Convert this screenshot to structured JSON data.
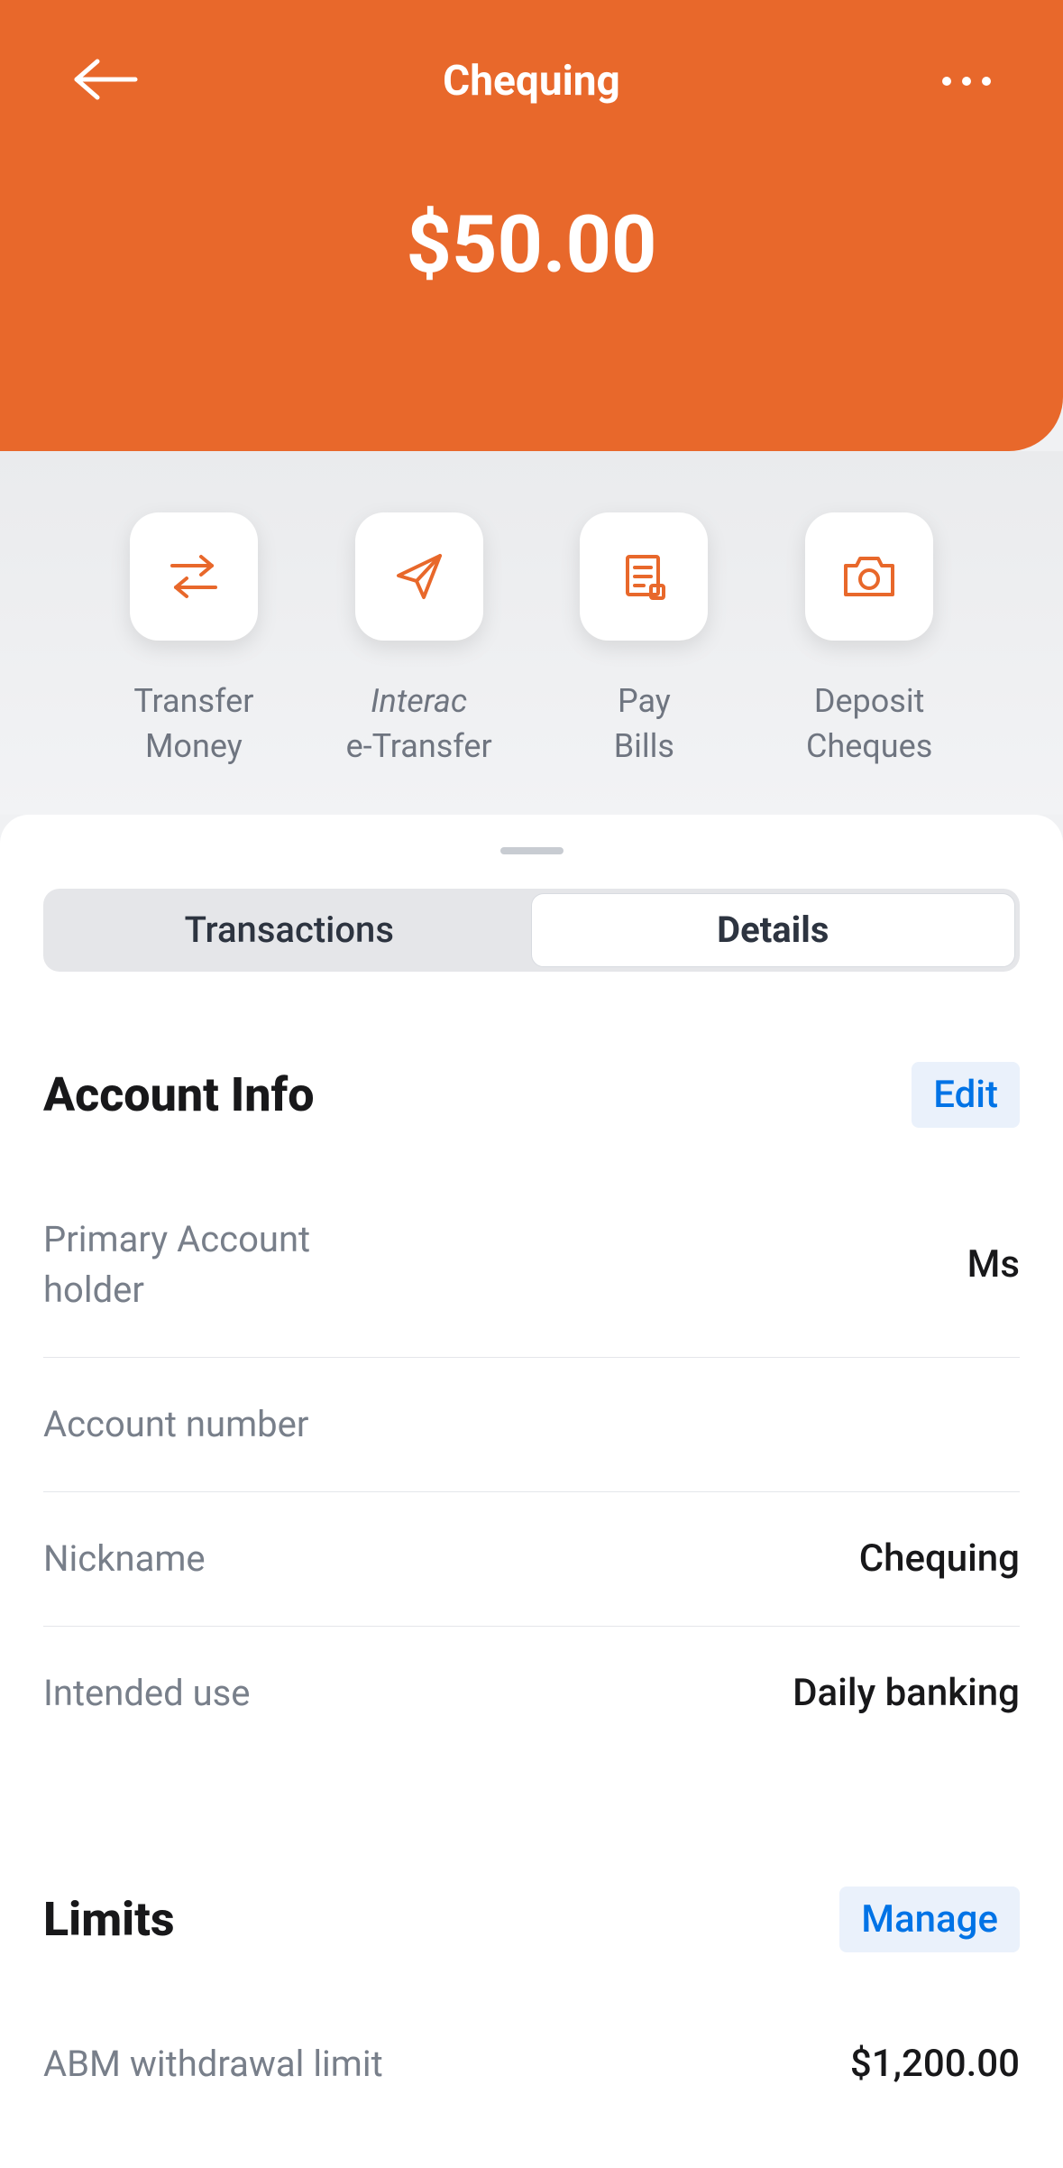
{
  "header": {
    "title": "Chequing",
    "balance": "$50.00"
  },
  "actions": [
    {
      "label_line1": "Transfer",
      "label_line2": "Money"
    },
    {
      "label_line1": "Interac",
      "label_line2": "e-Transfer",
      "interac": true
    },
    {
      "label_line1": "Pay",
      "label_line2": "Bills"
    },
    {
      "label_line1": "Deposit",
      "label_line2": "Cheques"
    }
  ],
  "tabs": {
    "transactions": "Transactions",
    "details": "Details"
  },
  "account_info": {
    "title": "Account Info",
    "edit": "Edit",
    "rows": [
      {
        "label": "Primary Account holder",
        "value": "Ms"
      },
      {
        "label": "Account number",
        "value": ""
      },
      {
        "label": "Nickname",
        "value": "Chequing"
      },
      {
        "label": "Intended use",
        "value": "Daily banking"
      }
    ]
  },
  "limits": {
    "title": "Limits",
    "manage": "Manage",
    "rows": [
      {
        "label": "ABM withdrawal limit",
        "value": "$1,200.00"
      }
    ]
  },
  "colors": {
    "accent": "#e8682b",
    "link": "#0073e6"
  }
}
